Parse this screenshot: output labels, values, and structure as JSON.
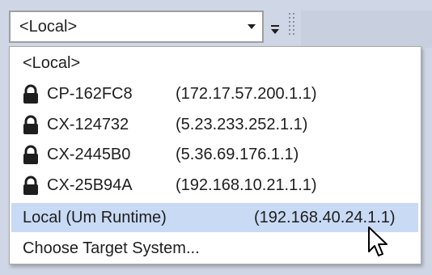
{
  "combo": {
    "selected_value": "<Local>"
  },
  "icons": {
    "combo_arrow": "chevron-down-icon",
    "toolbar_overflow": "overflow-dropdown-icon",
    "grip": "grip-icon",
    "lock": "lock-icon",
    "cursor": "mouse-pointer-icon"
  },
  "dropdown": {
    "items": [
      {
        "label": "<Local>",
        "address": "",
        "locked": false,
        "selected": false
      },
      {
        "label": "CP-162FC8",
        "address": "(172.17.57.200.1.1)",
        "locked": true,
        "selected": false
      },
      {
        "label": "CX-124732",
        "address": "(5.23.233.252.1.1)",
        "locked": true,
        "selected": false
      },
      {
        "label": "CX-2445B0",
        "address": "(5.36.69.176.1.1)",
        "locked": true,
        "selected": false
      },
      {
        "label": "CX-25B94A",
        "address": "(192.168.10.21.1.1)",
        "locked": true,
        "selected": false
      },
      {
        "label": "Local (Um Runtime)",
        "address": "(192.168.40.24.1.1)",
        "locked": false,
        "selected": true
      },
      {
        "label": "Choose Target System...",
        "address": "",
        "locked": false,
        "selected": false
      }
    ]
  },
  "colors": {
    "selection_highlight": "#c9daf5",
    "toolbar_background": "#cfd6e5"
  }
}
